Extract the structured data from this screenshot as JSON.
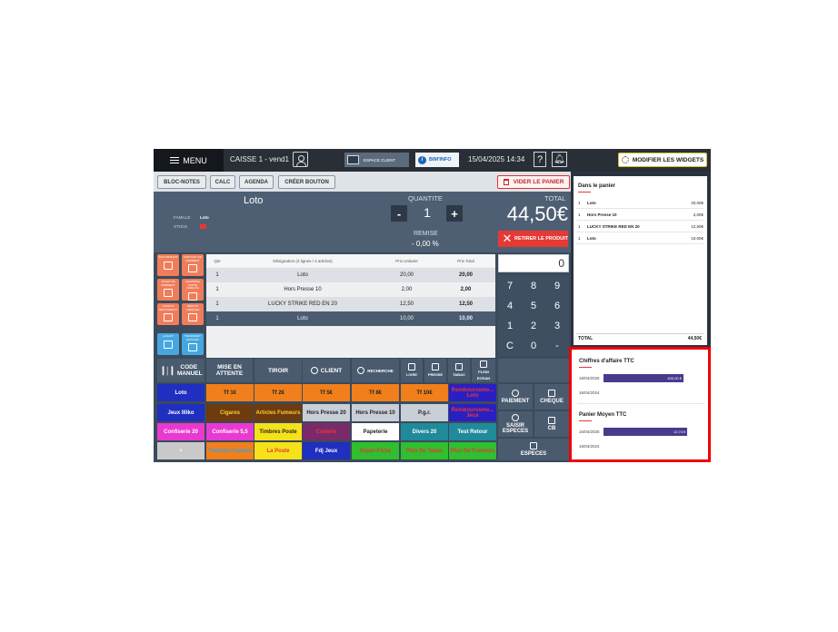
{
  "topbar": {
    "menu": "MENU",
    "caisse": "CAISSE 1 - vend1",
    "espace_client": "ESPACE CLIENT",
    "bim_info": "BIM'INFO",
    "datetime": "15/04/2025 14:34",
    "help": "?",
    "modifier_widgets": "MODIFIER LES WIDGETS"
  },
  "toolbar": {
    "bloc_notes": "BLOC-NOTES",
    "calc": "CALC",
    "agenda": "AGENDA",
    "creer_bouton": "CRÉER BOUTON",
    "vider": "VIDER LE PANIER"
  },
  "product": {
    "name": "Loto",
    "famille_label": "FAMILLE",
    "famille_value": "Loto",
    "stock_label": "STOCK",
    "quantite_label": "QUANTITE",
    "quantite": "1",
    "remise_label": "REMISE",
    "remise": "- 0,00 %",
    "total_label": "TOTAL",
    "total": "44,50€",
    "retirer": "RETIRER LE PRODUIT"
  },
  "shortcuts": [
    {
      "label": "ÉCO PRODUIT",
      "color": "orange"
    },
    {
      "label": "MONTANT DE PAIEMENT",
      "color": "orange"
    },
    {
      "label": "TICKET DE PAIEMENT",
      "color": "orange"
    },
    {
      "label": "SHOPPING CARTE FIDELITE",
      "color": "orange"
    },
    {
      "label": "TICKETS RESTAURANT",
      "color": "orange"
    },
    {
      "label": "DÉPOTS CHÈQUES",
      "color": "orange"
    },
    {
      "label": "E-SHOP",
      "color": "blue"
    },
    {
      "label": "TRANSFERT ENCAISS",
      "color": "blue"
    }
  ],
  "ticket": {
    "headers": [
      "Qte",
      "Désignation (4 lignes / 4 articles)",
      "Prix Unitaire",
      "Prix Total"
    ],
    "rows": [
      {
        "qte": "1",
        "designation": "Loto",
        "pu": "20,00",
        "total": "20,00"
      },
      {
        "qte": "1",
        "designation": "Hors Presse 10",
        "pu": "2,00",
        "total": "2,00"
      },
      {
        "qte": "1",
        "designation": "LUCKY STRIKE RED EN 20",
        "pu": "12,50",
        "total": "12,50"
      },
      {
        "qte": "1",
        "designation": "Loto",
        "pu": "10,00",
        "total": "10,00"
      }
    ]
  },
  "numpad": {
    "display": "0",
    "keys": [
      "7",
      "8",
      "9",
      "4",
      "5",
      "6",
      "1",
      "2",
      "3",
      "C",
      "0",
      "-"
    ]
  },
  "actions": {
    "code_manuel": "CODE MANUEL",
    "mise_en_attente": "MISE EN ATTENTE",
    "tiroir": "TIROIR",
    "client": "CLIENT",
    "recherche": "RECHERCHE",
    "livre": "LIVRE",
    "presse": "PRESSE",
    "tabac": "TABAC",
    "plein_ecran": "PLEIN ECRAN"
  },
  "product_buttons": [
    {
      "label": "Loto",
      "bg": "#1f2fbf",
      "fg": "#ffffff"
    },
    {
      "label": "Tf 1€",
      "bg": "#f07f1c",
      "fg": "#222222"
    },
    {
      "label": "Tf 2€",
      "bg": "#f07f1c",
      "fg": "#222222"
    },
    {
      "label": "Tf 5€",
      "bg": "#f07f1c",
      "fg": "#222222"
    },
    {
      "label": "Tf 8€",
      "bg": "#f07f1c",
      "fg": "#222222"
    },
    {
      "label": "Tf 10€",
      "bg": "#f07f1c",
      "fg": "#222222"
    },
    {
      "label": "Rembourseme... Loto",
      "bg": "#2a1fc2",
      "fg": "#e53935"
    },
    {
      "label": "Jeux Illiko",
      "bg": "#1f2fbf",
      "fg": "#ffffff"
    },
    {
      "label": "Cigares",
      "bg": "#6d3b0e",
      "fg": "#f5d23a"
    },
    {
      "label": "Articles Fumeurs",
      "bg": "#6d3b0e",
      "fg": "#f5d23a"
    },
    {
      "label": "Hors Presse 20",
      "bg": "#c9cfd6",
      "fg": "#222222"
    },
    {
      "label": "Hors Presse 10",
      "bg": "#c9cfd6",
      "fg": "#222222"
    },
    {
      "label": "P.g.r.",
      "bg": "#c9cfd6",
      "fg": "#222222"
    },
    {
      "label": "Rembourseme... Jeux",
      "bg": "#2a1fc2",
      "fg": "#e53935"
    },
    {
      "label": "Confiserie 20",
      "bg": "#e83ad0",
      "fg": "#ffffff"
    },
    {
      "label": "Confiserie 5,5",
      "bg": "#e83ad0",
      "fg": "#ffffff"
    },
    {
      "label": "Timbres Poste",
      "bg": "#f5e21a",
      "fg": "#222222"
    },
    {
      "label": "Carterie",
      "bg": "#7a2a6a",
      "fg": "#e53935"
    },
    {
      "label": "Papeterie",
      "bg": "#ffffff",
      "fg": "#222222"
    },
    {
      "label": "Divers 20",
      "bg": "#1f8a9a",
      "fg": "#ffffff"
    },
    {
      "label": "Test Retour",
      "bg": "#1f8a9a",
      "fg": "#ffffff"
    },
    {
      "label": "+",
      "bg": "#c9c9c9",
      "fg": "#ffffff"
    },
    {
      "label": "Timbres Fiscaux",
      "bg": "#f07f1c",
      "fg": "#3aa0e0"
    },
    {
      "label": "La Poste",
      "bg": "#f5e21a",
      "fg": "#e53935"
    },
    {
      "label": "Fdj Jeux",
      "bg": "#1f2fbf",
      "fg": "#ffffff"
    },
    {
      "label": "Super-Fiche",
      "bg": "#2fbf2f",
      "fg": "#e53935"
    },
    {
      "label": "Plus De Tabac",
      "bg": "#2fbf2f",
      "fg": "#e53935"
    },
    {
      "label": "Plus De Fumeurs",
      "bg": "#2fbf2f",
      "fg": "#e53935"
    }
  ],
  "payment": {
    "paiement": "PAIEMENT",
    "cheque": "CHEQUE",
    "saisir_especes": "SAISIR ESPECES",
    "cb": "CB",
    "especes": "ESPECES"
  },
  "basket": {
    "title": "Dans le panier",
    "items": [
      {
        "qte": "1",
        "name": "Loto",
        "price": "20,00€"
      },
      {
        "qte": "1",
        "name": "Hors Presse 10",
        "price": "2,00€"
      },
      {
        "qte": "1",
        "name": "LUCKY STRIKE RED EN 20",
        "price": "12,50€"
      },
      {
        "qte": "1",
        "name": "Loto",
        "price": "10,00€"
      }
    ],
    "total_label": "TOTAL",
    "total": "44,50€"
  },
  "widgets": {
    "ca_title": "Chiffres d'affaire TTC",
    "ca_rows": [
      {
        "date": "15/04/2025",
        "value": "400,00 €",
        "fraction": 1.0
      },
      {
        "date": "16/04/2024",
        "value": "",
        "fraction": 0
      }
    ],
    "pm_title": "Panier Moyen TTC",
    "pm_rows": [
      {
        "date": "15/04/2025",
        "value": "12,74 €",
        "fraction": 1.0
      },
      {
        "date": "16/04/2024",
        "value": "",
        "fraction": 0
      }
    ],
    "accent": "#4a3a8c"
  }
}
